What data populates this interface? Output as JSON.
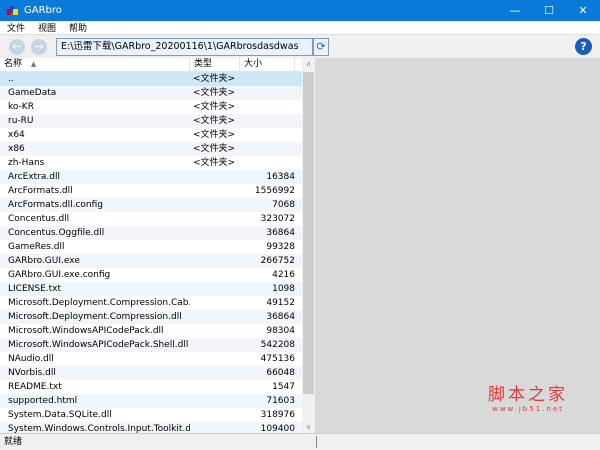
{
  "window": {
    "title": "GARbro"
  },
  "menu": [
    "文件",
    "视图",
    "帮助"
  ],
  "toolbar": {
    "back": "←",
    "forward": "→",
    "path": "E:\\迅雷下载\\GARbro_20200116\\1\\GARbrosdasdwas",
    "refresh": "⟳",
    "help": "?"
  },
  "columns": {
    "name": "名称",
    "type": "类型",
    "size": "大小"
  },
  "files": [
    {
      "name": "..",
      "type": "<文件夹>",
      "size": ""
    },
    {
      "name": "GameData",
      "type": "<文件夹>",
      "size": ""
    },
    {
      "name": "ko-KR",
      "type": "<文件夹>",
      "size": ""
    },
    {
      "name": "ru-RU",
      "type": "<文件夹>",
      "size": ""
    },
    {
      "name": "x64",
      "type": "<文件夹>",
      "size": ""
    },
    {
      "name": "x86",
      "type": "<文件夹>",
      "size": ""
    },
    {
      "name": "zh-Hans",
      "type": "<文件夹>",
      "size": ""
    },
    {
      "name": "ArcExtra.dll",
      "type": "",
      "size": "16384"
    },
    {
      "name": "ArcFormats.dll",
      "type": "",
      "size": "1556992"
    },
    {
      "name": "ArcFormats.dll.config",
      "type": "",
      "size": "7068"
    },
    {
      "name": "Concentus.dll",
      "type": "",
      "size": "323072"
    },
    {
      "name": "Concentus.Oggfile.dll",
      "type": "",
      "size": "36864"
    },
    {
      "name": "GameRes.dll",
      "type": "",
      "size": "99328"
    },
    {
      "name": "GARbro.GUI.exe",
      "type": "",
      "size": "266752"
    },
    {
      "name": "GARbro.GUI.exe.config",
      "type": "",
      "size": "4216"
    },
    {
      "name": "LICENSE.txt",
      "type": "",
      "size": "1098"
    },
    {
      "name": "Microsoft.Deployment.Compression.Cab.dll",
      "type": "",
      "size": "49152"
    },
    {
      "name": "Microsoft.Deployment.Compression.dll",
      "type": "",
      "size": "36864"
    },
    {
      "name": "Microsoft.WindowsAPICodePack.dll",
      "type": "",
      "size": "98304"
    },
    {
      "name": "Microsoft.WindowsAPICodePack.Shell.dll",
      "type": "",
      "size": "542208"
    },
    {
      "name": "NAudio.dll",
      "type": "",
      "size": "475136"
    },
    {
      "name": "NVorbis.dll",
      "type": "",
      "size": "66048"
    },
    {
      "name": "README.txt",
      "type": "",
      "size": "1547"
    },
    {
      "name": "supported.html",
      "type": "",
      "size": "71603"
    },
    {
      "name": "System.Data.SQLite.dll",
      "type": "",
      "size": "318976"
    },
    {
      "name": "System.Windows.Controls.Input.Toolkit.dll",
      "type": "",
      "size": "109400"
    }
  ],
  "watermark": {
    "line1": "脚本之家",
    "line2": "www.jb51.net"
  },
  "status": "就绪"
}
